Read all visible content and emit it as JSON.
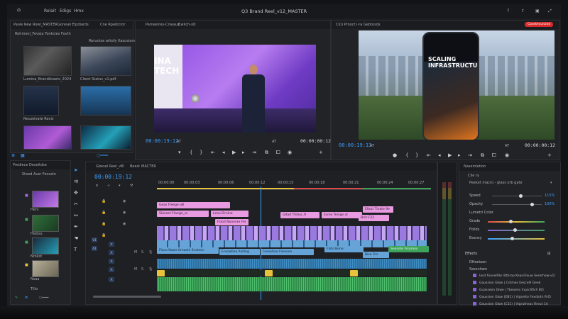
{
  "app": {
    "title": "Q3 Brand Reel_v12_MASTER",
    "menu": [
      "Relait",
      "Edigs",
      "Hmx"
    ]
  },
  "project_panel": {
    "tabs": [
      "Paoie Rew Rowl_MASTER",
      "Goresel Eipdiards",
      "Cne Rpedicror"
    ],
    "header": "Rohmeol_Feveja Tonkcies Fovth",
    "items": [
      {
        "label": "Lumina_BrandAssets_2024"
      },
      {
        "label": "Client Status_v1.pdf"
      },
      {
        "label": "Resuelvate Revis"
      },
      {
        "label": ""
      },
      {
        "label": ""
      },
      {
        "label": ""
      }
    ]
  },
  "proj_right_header": "Roruntse witsily Kasusions",
  "source_monitor": {
    "tabs": [
      "Pameelrey-Cnieaub",
      "Cwilch-sO"
    ],
    "timecode": "00:00:19:12",
    "duration": "00:00:00:12",
    "zoom": "AT"
  },
  "program_monitor": {
    "tab": "Cl(i) Prooct i-ra Gebtosds",
    "badge": "Cpoxtecuiuiod",
    "timecode": "00:00:19:13",
    "duration": "00:00:00:12",
    "zoom": "AT",
    "phone_text": "SCALING INFRASTRUCTURE."
  },
  "media_browser": {
    "tabs": [
      "Prediece Deseitdse",
      "Stoed Ausr Fecastn"
    ],
    "bins": [
      {
        "label": "Hers"
      },
      {
        "label": "Hiebss"
      },
      {
        "label": "Nrokst"
      },
      {
        "label": "Nsaa"
      },
      {
        "label": "Tillo"
      }
    ]
  },
  "timeline": {
    "tabs": [
      "Gbesel Reel_v8l",
      "Beed: MACTER"
    ],
    "timecode": "00:00:19:12",
    "ruler": [
      "00:00:00",
      "00:00:03",
      "00:00:06",
      "00:00:12",
      "00:00:15",
      "00:00:18",
      "00:00:21",
      "00:00:24",
      "00:00:27"
    ],
    "graphics_clips": [
      "Geas Fleege oB",
      "Slanset Fdurge_or",
      "Lceul Ernine",
      "Gltad Tfeliur_9",
      "Esrex Tenige ol",
      "Eltocl Tinate 9e",
      "Fslod Noonrae Fer",
      "Brilr F22"
    ],
    "audio_clips": [
      "Piaco Naws Ureaale Sesteon",
      "Ensaatlea Alsiteg",
      "Fesnetiae Faessea",
      "Flsto Bone",
      "Bisa Frls",
      "Seasote Frsorons"
    ]
  },
  "lumetri": {
    "tab": "Nasemletion",
    "section": "Cile ry",
    "preset": "Peeket macro - glass orb gate",
    "controls": [
      {
        "label": "Speed",
        "value": "115%",
        "pos": 0.6
      },
      {
        "label": "Opacity",
        "value": "100%",
        "pos": 0.78
      },
      {
        "label": "Lumetri Color",
        "value": "",
        "pos": 0
      },
      {
        "label": "Grade",
        "value": "",
        "pos": 0.38
      },
      {
        "label": "Folids",
        "value": "",
        "pos": 0.47
      },
      {
        "label": "Esansy",
        "value": "",
        "pos": 0.42
      }
    ],
    "effects_header": "Effects",
    "effects_sub": [
      "Dfteeiaen",
      "Ssesnhwn"
    ],
    "effects": [
      "Iasd fonvelhte Iitthrao Kean(Feuw Sererhow-v1l",
      "Gaussion Glow | Cntmes Eescelll Geek",
      "Guasseon Glwe | Tbeuens Inpsclifich Bi5",
      "Gaussion Glow (EB1) | Vigneite Fexdiotn Rrl5",
      "Gaussion Glow (C51) | Vigrutheas Rreut 14"
    ]
  }
}
